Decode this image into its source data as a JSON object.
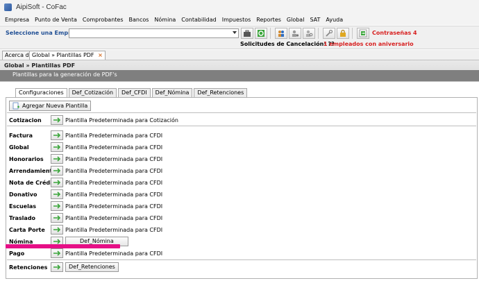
{
  "window": {
    "title": "AipiSoft - CoFac"
  },
  "menu": [
    "Empresa",
    "Punto de Venta",
    "Comprobantes",
    "Bancos",
    "Nómina",
    "Contabilidad",
    "Impuestos",
    "Reportes",
    "Global",
    "SAT",
    "Ayuda"
  ],
  "toolbar": {
    "select_label": "Seleccione una Empresa",
    "company_value": "",
    "password_alert": "Contraseñas 4",
    "cancel_requests": "Solicitudes de Cancelación: ??",
    "anniversary": "1 empleados con aniversario"
  },
  "doc_tabs": [
    "Acerca de",
    "Global » Plantillas PDF"
  ],
  "page": {
    "breadcrumb": "Global » Plantillas PDF",
    "subtitle": "Plantillas para la generación de PDF's"
  },
  "tabs": [
    "Configuraciones",
    "Def_Cotización",
    "Def_CFDI",
    "Def_Nómina",
    "Def_Retenciones"
  ],
  "add_button": "Agregar Nueva Plantilla",
  "rows": [
    {
      "label": "Cotizacion",
      "value": "Plantilla Predeterminada para Cotización"
    },
    {
      "label": "Factura",
      "value": "Plantilla Predeterminada para CFDI"
    },
    {
      "label": "Global",
      "value": "Plantilla Predeterminada para CFDI"
    },
    {
      "label": "Honorarios",
      "value": "Plantilla Predeterminada para CFDI"
    },
    {
      "label": "Arrendamiento",
      "value": "Plantilla Predeterminada para CFDI"
    },
    {
      "label": "Nota de Crédito",
      "value": "Plantilla Predeterminada para CFDI"
    },
    {
      "label": "Donativo",
      "value": "Plantilla Predeterminada para CFDI"
    },
    {
      "label": "Escuelas",
      "value": "Plantilla Predeterminada para CFDI"
    },
    {
      "label": "Traslado",
      "value": "Plantilla Predeterminada para CFDI"
    },
    {
      "label": "Carta Porte",
      "value": "Plantilla Predeterminada para CFDI"
    },
    {
      "label": "Nómina",
      "value": "Def_Nómina"
    },
    {
      "label": "Pago",
      "value": "Plantilla Predeterminada para CFDI"
    },
    {
      "label": "Retenciones",
      "value": "Def_Retenciones"
    }
  ],
  "colors": {
    "alert": "#d71f1f",
    "label_blue": "#1f4e94",
    "highlight": "#e60f86",
    "arrow": "#3aa53a"
  }
}
